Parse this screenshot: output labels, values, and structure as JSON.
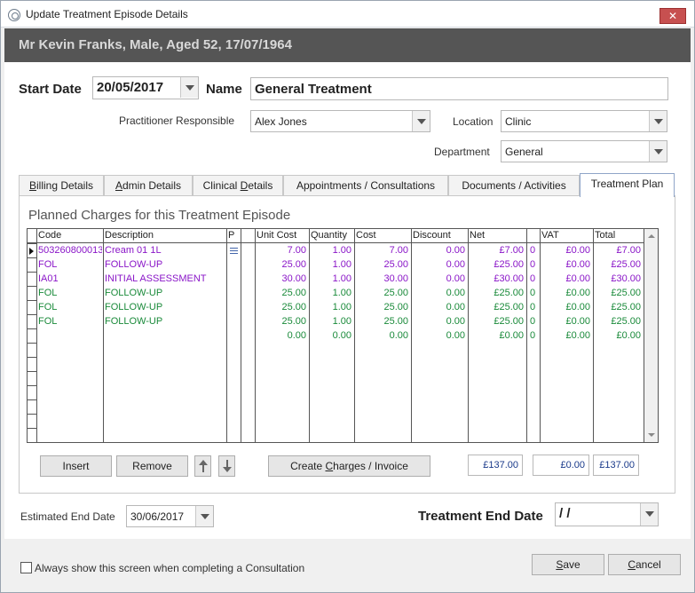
{
  "window": {
    "title": "Update Treatment Episode Details",
    "close_label": "✕"
  },
  "patient": {
    "summary": "Mr Kevin Franks, Male, Aged 52, 17/07/1964"
  },
  "form": {
    "start_date_label": "Start Date",
    "start_date": "20/05/2017",
    "name_label": "Name",
    "name": "General Treatment",
    "practitioner_label": "Practitioner Responsible",
    "practitioner": "Alex Jones",
    "location_label": "Location",
    "location": "Clinic",
    "department_label": "Department",
    "department": "General"
  },
  "tabs": [
    {
      "label_pre": "",
      "label_u": "B",
      "label_post": "illing Details"
    },
    {
      "label_pre": "",
      "label_u": "A",
      "label_post": "dmin Details"
    },
    {
      "label_pre": "Clinical ",
      "label_u": "D",
      "label_post": "etails"
    },
    {
      "label_pre": "Appointments / Consultations",
      "label_u": "",
      "label_post": ""
    },
    {
      "label_pre": "Documents / Activities",
      "label_u": "",
      "label_post": ""
    },
    {
      "label_pre": "Treatment Plan",
      "label_u": "",
      "label_post": ""
    }
  ],
  "plan": {
    "heading": "Planned Charges for this Treatment Episode",
    "columns": [
      "Code",
      "Description",
      "P",
      "",
      "Unit Cost",
      "Quantity",
      "Cost",
      "Discount",
      "Net",
      "",
      "VAT",
      "Total"
    ],
    "rows": [
      {
        "code": "503260800013",
        "desc": "Cream 01 1L",
        "unit": "7.00",
        "qty": "1.00",
        "cost": "7.00",
        "disc": "0.00",
        "net": "£7.00",
        "vc": "0",
        "vat": "£0.00",
        "total": "£7.00",
        "color": "#8a16c8",
        "icon": true
      },
      {
        "code": "FOL",
        "desc": "FOLLOW-UP",
        "unit": "25.00",
        "qty": "1.00",
        "cost": "25.00",
        "disc": "0.00",
        "net": "£25.00",
        "vc": "0",
        "vat": "£0.00",
        "total": "£25.00",
        "color": "#8a16c8",
        "icon": false
      },
      {
        "code": "IA01",
        "desc": "INITIAL ASSESSMENT",
        "unit": "30.00",
        "qty": "1.00",
        "cost": "30.00",
        "disc": "0.00",
        "net": "£30.00",
        "vc": "0",
        "vat": "£0.00",
        "total": "£30.00",
        "color": "#8a16c8",
        "icon": false
      },
      {
        "code": "FOL",
        "desc": "FOLLOW-UP",
        "unit": "25.00",
        "qty": "1.00",
        "cost": "25.00",
        "disc": "0.00",
        "net": "£25.00",
        "vc": "0",
        "vat": "£0.00",
        "total": "£25.00",
        "color": "#1a8a3a",
        "icon": false
      },
      {
        "code": "FOL",
        "desc": "FOLLOW-UP",
        "unit": "25.00",
        "qty": "1.00",
        "cost": "25.00",
        "disc": "0.00",
        "net": "£25.00",
        "vc": "0",
        "vat": "£0.00",
        "total": "£25.00",
        "color": "#1a8a3a",
        "icon": false
      },
      {
        "code": "FOL",
        "desc": "FOLLOW-UP",
        "unit": "25.00",
        "qty": "1.00",
        "cost": "25.00",
        "disc": "0.00",
        "net": "£25.00",
        "vc": "0",
        "vat": "£0.00",
        "total": "£25.00",
        "color": "#1a8a3a",
        "icon": false
      },
      {
        "code": "",
        "desc": "",
        "unit": "0.00",
        "qty": "0.00",
        "cost": "0.00",
        "disc": "0.00",
        "net": "£0.00",
        "vc": "0",
        "vat": "£0.00",
        "total": "£0.00",
        "color": "#1a8a3a",
        "icon": false
      }
    ],
    "insert_label": "Insert",
    "remove_label": "Remove",
    "create_charges_pre": "Create ",
    "create_charges_u": "C",
    "create_charges_post": "harges / Invoice",
    "net_total": "£137.00",
    "vat_total": "£0.00",
    "grand_total": "£137.00"
  },
  "end": {
    "estimated_label": "Estimated End Date",
    "estimated": "30/06/2017",
    "treatment_end_label": "Treatment End Date",
    "treatment_end": " / /"
  },
  "footer": {
    "always_show_label": "Always show this screen when completing a Consultation",
    "save_u": "S",
    "save_post": "ave",
    "cancel_u": "C",
    "cancel_post": "ancel"
  },
  "colors": {
    "purple_text": "#8a16c8",
    "green_text": "#1a8a3a",
    "header_bar": "#555555"
  }
}
